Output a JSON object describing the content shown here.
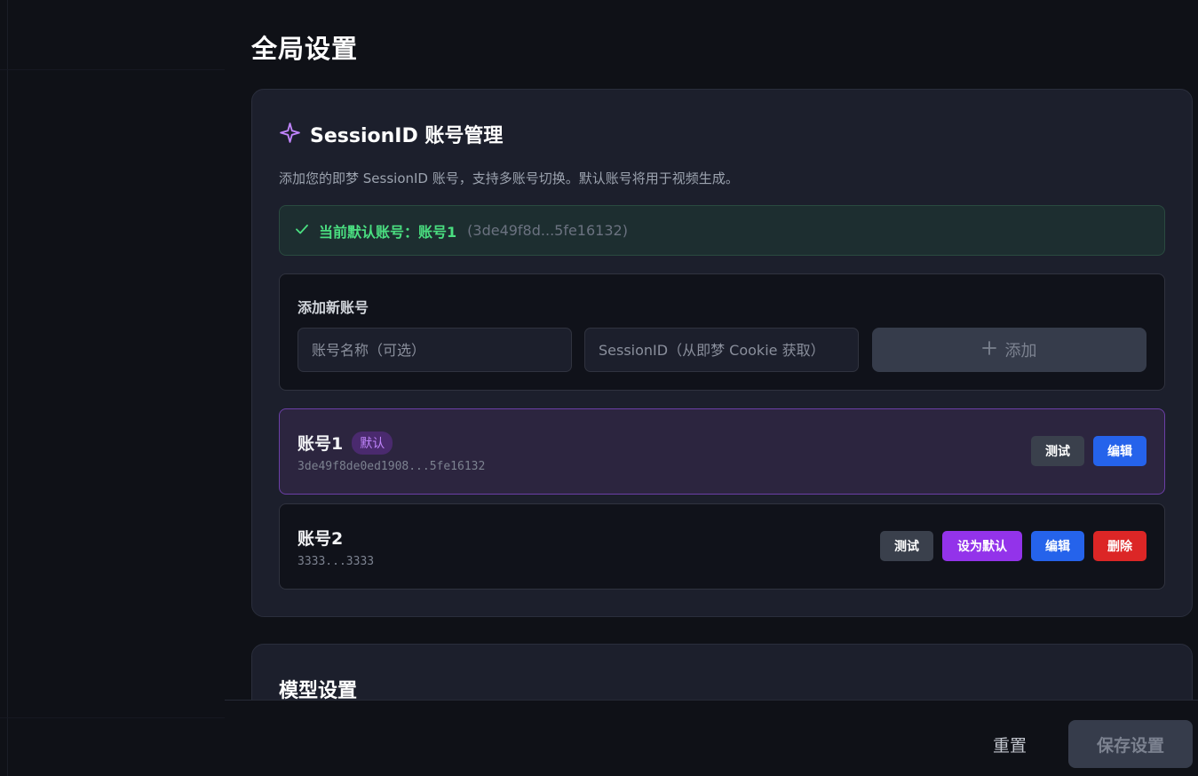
{
  "page": {
    "title": "全局设置"
  },
  "session_card": {
    "title": "SessionID 账号管理",
    "description": "添加您的即梦 SessionID 账号，支持多账号切换。默认账号将用于视频生成。",
    "default_banner": {
      "label": "当前默认账号：账号1",
      "hash": "(3de49f8d...5fe16132)"
    },
    "add_box": {
      "title": "添加新账号",
      "name_placeholder": "账号名称（可选）",
      "sid_placeholder": "SessionID（从即梦 Cookie 获取）",
      "add_label": "添加"
    },
    "accounts": [
      {
        "name": "账号1",
        "badge": "默认",
        "hash": "3de49f8de0ed1908...5fe16132",
        "actions": {
          "test": "测试",
          "edit": "编辑"
        }
      },
      {
        "name": "账号2",
        "hash": "3333...3333",
        "actions": {
          "test": "测试",
          "set_default": "设为默认",
          "edit": "编辑",
          "delete": "删除"
        }
      }
    ]
  },
  "model_card": {
    "title": "模型设置"
  },
  "footer": {
    "reset": "重置",
    "save": "保存设置"
  },
  "icons": {
    "title_icon": "sparkle-icon",
    "banner_icon": "check-icon",
    "add_icon": "plus-icon"
  },
  "colors": {
    "accent_purple": "#9333ea",
    "accent_blue": "#2563eb",
    "danger_red": "#dc2626",
    "success_green": "#4ade80"
  }
}
